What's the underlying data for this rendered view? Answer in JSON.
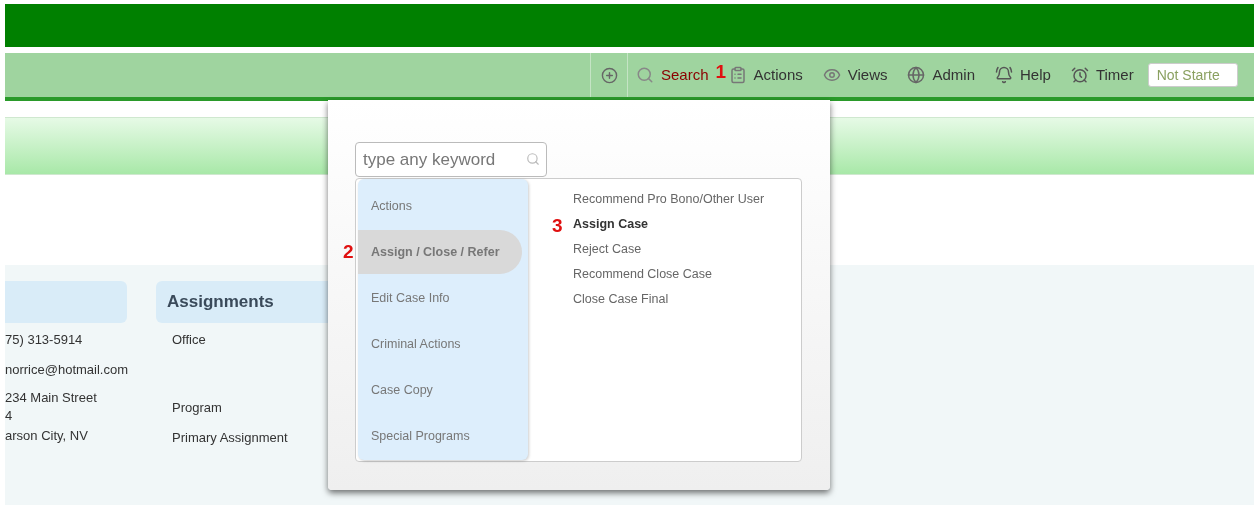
{
  "toolbar": {
    "items": [
      {
        "kind": "add"
      },
      {
        "kind": "search",
        "label": "Search",
        "highlighted": true
      },
      {
        "kind": "actions",
        "label": "Actions",
        "highlighted": false,
        "marker": "1"
      },
      {
        "kind": "views",
        "label": "Views",
        "highlighted": false
      },
      {
        "kind": "admin",
        "label": "Admin",
        "highlighted": false
      },
      {
        "kind": "help",
        "label": "Help",
        "highlighted": false
      },
      {
        "kind": "timer",
        "label": "Timer",
        "highlighted": false
      }
    ],
    "timer_field": {
      "value": "Not Starte"
    }
  },
  "contact": {
    "lines": [
      "75) 313-5914",
      "norrice@hotmail.com",
      "234 Main Street",
      "4",
      "arson City, NV"
    ]
  },
  "assignments": {
    "title": "Assignments",
    "rows": [
      "Office",
      "Program",
      "Primary Assignment"
    ]
  },
  "popup": {
    "search": {
      "placeholder": "type any keyword"
    },
    "categories": [
      {
        "label": "Actions",
        "selected": false
      },
      {
        "label": "Assign / Close / Refer",
        "selected": true,
        "marker": "2"
      },
      {
        "label": "Edit Case Info",
        "selected": false
      },
      {
        "label": "Criminal Actions",
        "selected": false
      },
      {
        "label": "Case Copy",
        "selected": false
      },
      {
        "label": "Special Programs",
        "selected": false
      }
    ],
    "actions": [
      {
        "label": "Recommend Pro Bono/Other User",
        "selected": false
      },
      {
        "label": "Assign Case",
        "selected": true,
        "marker": "3"
      },
      {
        "label": "Reject Case",
        "selected": false
      },
      {
        "label": "Recommend Close Case",
        "selected": false
      },
      {
        "label": "Close Case Final",
        "selected": false
      }
    ]
  }
}
